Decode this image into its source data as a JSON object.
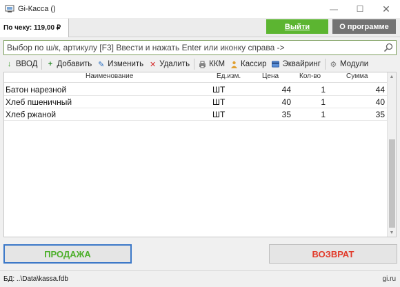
{
  "window": {
    "title": "Gi-Касса ()"
  },
  "header": {
    "total_label": "По чеку: 119,00 ₽",
    "exit_label": "Выйти",
    "about_label": "О программе"
  },
  "search": {
    "placeholder": "Выбор по ш/к, артикулу [F3] Ввести и нажать Enter или иконку справа ->"
  },
  "toolbar": {
    "enter_label": "ВВОД",
    "add_label": "Добавить",
    "edit_label": "Изменить",
    "delete_label": "Удалить",
    "kkm_label": "ККМ",
    "cashier_label": "Кассир",
    "acquiring_label": "Эквайринг",
    "modules_label": "Модули"
  },
  "table": {
    "headers": {
      "name": "Наименование",
      "unit": "Ед.изм.",
      "price": "Цена",
      "qty": "Кол-во",
      "sum": "Сумма"
    },
    "rows": [
      {
        "name": "Батон нарезной",
        "unit": "ШТ",
        "price": "44",
        "qty": "1",
        "sum": "44"
      },
      {
        "name": "Хлеб пшеничный",
        "unit": "ШТ",
        "price": "40",
        "qty": "1",
        "sum": "40"
      },
      {
        "name": "Хлеб ржаной",
        "unit": "ШТ",
        "price": "35",
        "qty": "1",
        "sum": "35"
      }
    ]
  },
  "actions": {
    "sale_label": "ПРОДАЖА",
    "return_label": "ВОЗВРАТ"
  },
  "status": {
    "db_path": "БД: ..\\Data\\kassa.fdb",
    "site": "gi.ru"
  },
  "colors": {
    "exit_green": "#5cb531",
    "sale_green": "#4caf2a",
    "return_red": "#e23a2a",
    "about_gray": "#737373",
    "focus_blue": "#3b78c8"
  }
}
